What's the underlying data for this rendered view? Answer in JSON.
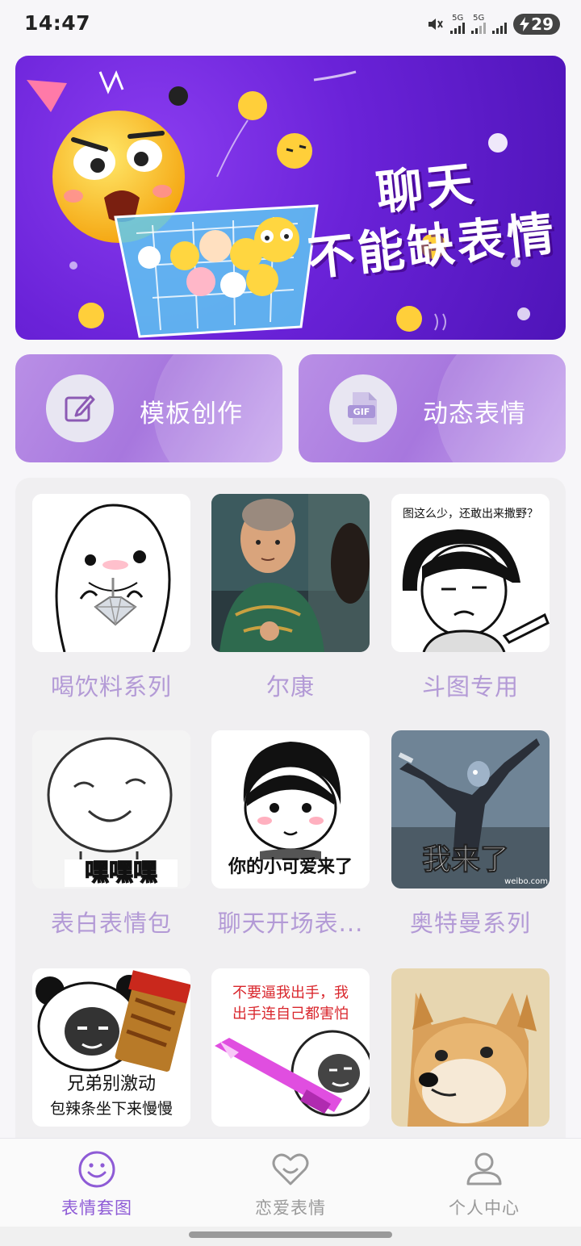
{
  "status": {
    "time": "14:47",
    "net1": "5G",
    "net2": "5G",
    "battery": "29"
  },
  "banner": {
    "title": "聊天\n不能缺表情"
  },
  "features": [
    {
      "label": "模板创作",
      "icon": "edit-icon"
    },
    {
      "label": "动态表情",
      "icon": "gif-icon",
      "icon_text": "GIF"
    }
  ],
  "grid": [
    {
      "caption": "喝饮料系列"
    },
    {
      "caption": "尔康"
    },
    {
      "caption": "斗图专用",
      "image_text": "图这么少，还敢出来撒野？"
    },
    {
      "caption": "表白表情包",
      "image_text": "嘿嘿嘿"
    },
    {
      "caption": "聊天开场表...",
      "image_text": "你的小可爱来了"
    },
    {
      "caption": "奥特曼系列",
      "image_text": "我来了",
      "watermark": "weibo.com"
    },
    {
      "caption": "",
      "image_text": "兄弟别激动",
      "image_text2": "包辣条坐下来慢慢"
    },
    {
      "caption": "",
      "image_text": "不要逼我出手，我",
      "image_text2": "出手连自己都害怕"
    },
    {
      "caption": ""
    }
  ],
  "nav": [
    {
      "label": "表情套图",
      "icon": "smiley-icon",
      "active": true
    },
    {
      "label": "恋爱表情",
      "icon": "heart-icon",
      "active": false
    },
    {
      "label": "个人中心",
      "icon": "person-icon",
      "active": false
    }
  ],
  "colors": {
    "accent": "#8e5bd6",
    "caption": "#b39ad6",
    "banner": "#6a22d8"
  }
}
